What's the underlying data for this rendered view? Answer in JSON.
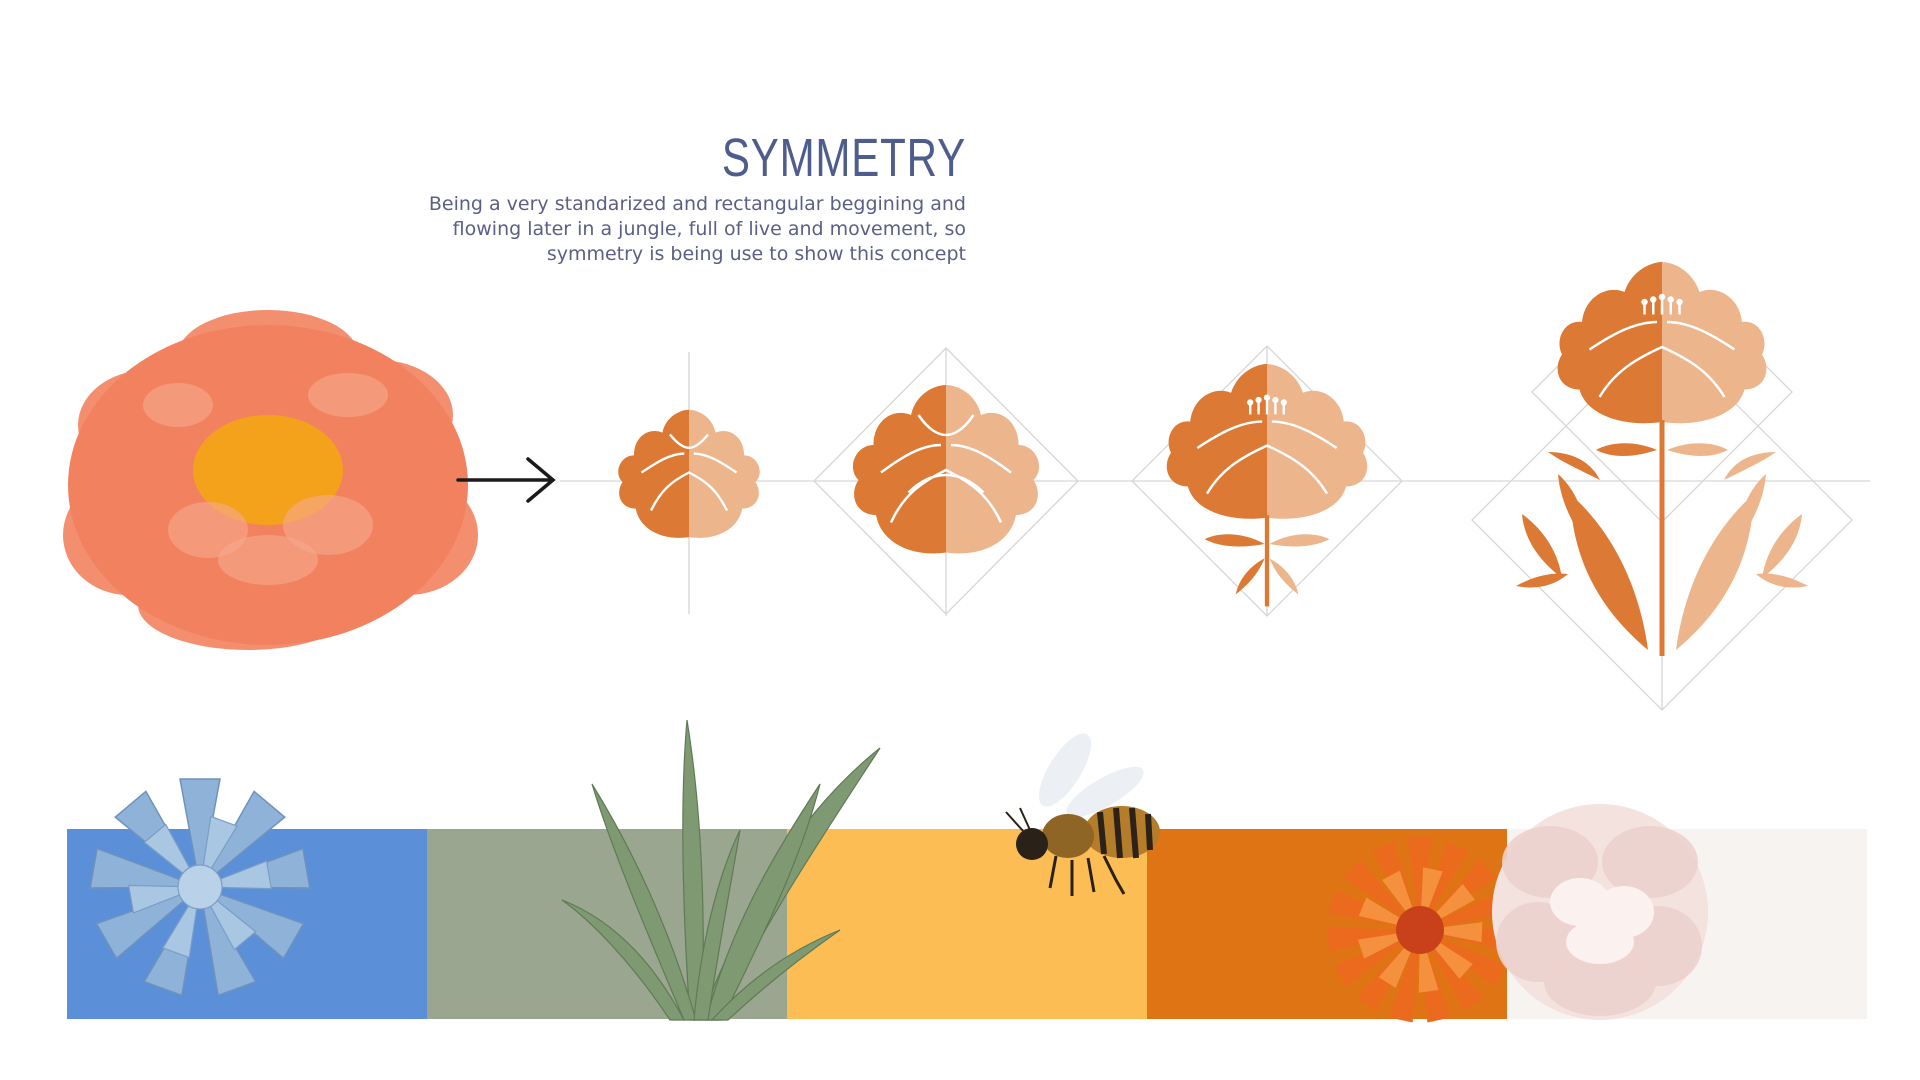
{
  "header": {
    "title": "SYMMETRY",
    "description_lines": [
      "Being a very standarized and rectangular beggining and",
      "flowing later in a jungle, full of  live and movement, so",
      "symmetry is being use to show this concept"
    ]
  },
  "colors": {
    "title": "#4f5d8e",
    "text": "#5b5f86",
    "flower_dark": "#dc7a35",
    "flower_light": "#ecb58c",
    "peony": "#f2825f",
    "peony_center": "#f4a21c",
    "guide": "#d6d6d6",
    "arrow": "#1a1a1a"
  },
  "icons": [
    "peony-photo-icon",
    "arrow-right-icon",
    "flower-stage-1-icon",
    "flower-stage-2-icon",
    "flower-stage-3-icon",
    "flower-stage-4-icon",
    "succulent-photo-icon",
    "aloe-photo-icon",
    "bee-photo-icon",
    "dahlia-photo-icon",
    "white-peony-photo-icon"
  ],
  "palette": [
    {
      "name": "blue",
      "color": "#5b90d8"
    },
    {
      "name": "sage",
      "color": "#9aa68f"
    },
    {
      "name": "yellow",
      "color": "#fcbd55"
    },
    {
      "name": "orange",
      "color": "#de7413"
    },
    {
      "name": "cream",
      "color": "#f7f3f1"
    }
  ]
}
